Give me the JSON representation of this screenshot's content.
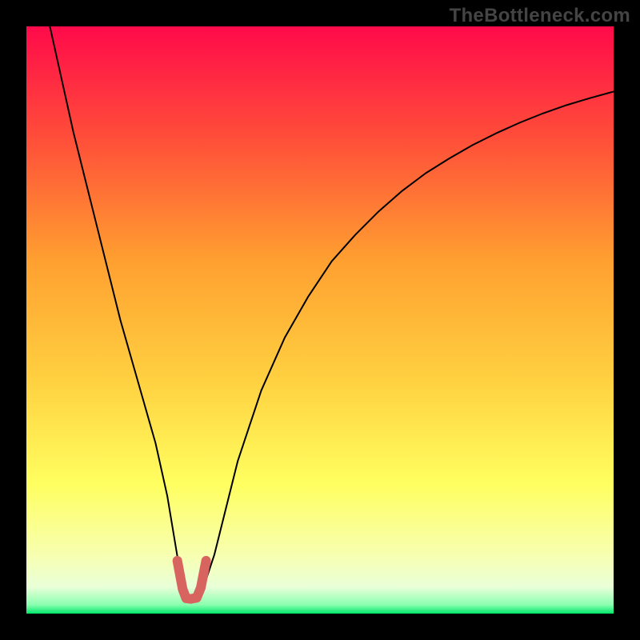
{
  "watermark": "TheBottleneck.com",
  "chart_data": {
    "type": "line",
    "title": "",
    "xlabel": "",
    "ylabel": "",
    "xlim": [
      0,
      100
    ],
    "ylim": [
      0,
      100
    ],
    "grid": false,
    "legend": false,
    "background_gradient_stops": [
      {
        "offset": 0.0,
        "color": "#ff0a4a"
      },
      {
        "offset": 0.18,
        "color": "#ff4a3a"
      },
      {
        "offset": 0.4,
        "color": "#ffa030"
      },
      {
        "offset": 0.6,
        "color": "#ffd040"
      },
      {
        "offset": 0.78,
        "color": "#ffff60"
      },
      {
        "offset": 0.9,
        "color": "#f7ffb0"
      },
      {
        "offset": 0.955,
        "color": "#e9ffd8"
      },
      {
        "offset": 0.985,
        "color": "#8affb0"
      },
      {
        "offset": 1.0,
        "color": "#00e66a"
      }
    ],
    "series": [
      {
        "name": "bottleneck-curve",
        "color": "#000000",
        "width": 2.0,
        "x": [
          4,
          6,
          8,
          10,
          12,
          14,
          16,
          18,
          20,
          22,
          24,
          25,
          26,
          27,
          28,
          29,
          30,
          32,
          34,
          36,
          38,
          40,
          44,
          48,
          52,
          56,
          60,
          64,
          68,
          72,
          76,
          80,
          84,
          88,
          92,
          96,
          100
        ],
        "y": [
          100,
          91,
          82,
          74,
          66,
          58,
          50,
          43,
          36,
          29,
          20,
          14,
          8,
          4,
          2.5,
          2.5,
          4,
          10,
          18,
          26,
          32,
          38,
          47,
          54,
          60,
          64.5,
          68.5,
          72,
          75,
          77.5,
          79.8,
          81.8,
          83.6,
          85.2,
          86.6,
          87.8,
          88.9
        ]
      },
      {
        "name": "optimal-marker",
        "color": "#d8645f",
        "width": 12,
        "cap": "round",
        "x": [
          25.7,
          26.6,
          27.2,
          28.0,
          29.0,
          29.7,
          30.6
        ],
        "y": [
          9.0,
          4.2,
          2.6,
          2.5,
          2.7,
          4.4,
          9.0
        ]
      }
    ]
  }
}
